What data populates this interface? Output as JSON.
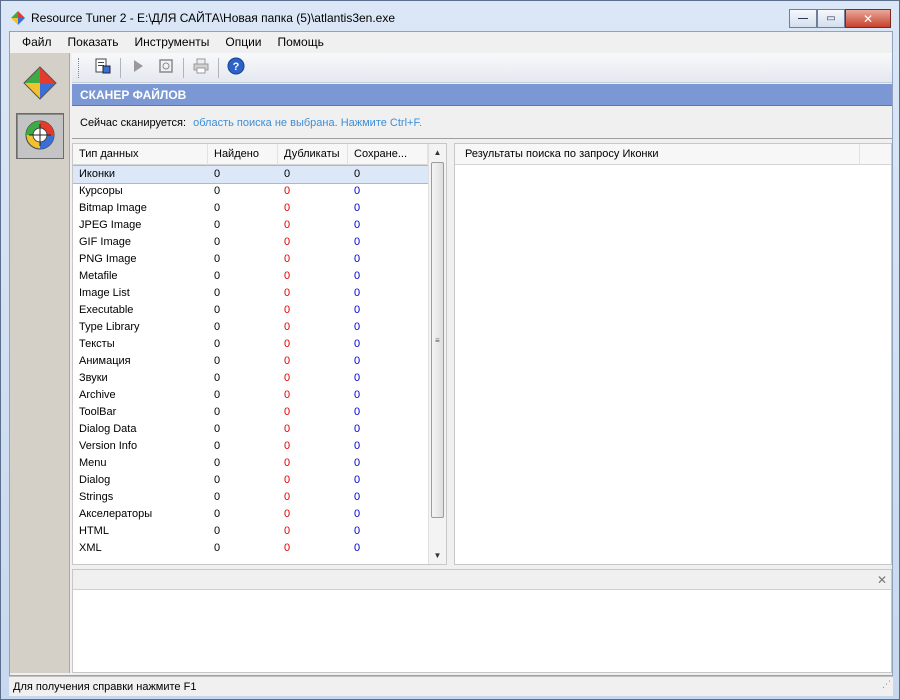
{
  "window": {
    "title": "Resource Tuner 2 - E:\\ДЛЯ САЙТА\\Новая папка (5)\\atlantis3en.exe"
  },
  "menu": {
    "items": [
      {
        "label": "Файл"
      },
      {
        "label": "Показать"
      },
      {
        "label": "Инструменты"
      },
      {
        "label": "Опции"
      },
      {
        "label": "Помощь"
      }
    ]
  },
  "toolbar": {
    "icons": [
      "open-file-icon",
      "play-icon",
      "stop-icon",
      "print-icon",
      "help-icon"
    ]
  },
  "section": {
    "title": "СКАНЕР ФАЙЛОВ"
  },
  "scan": {
    "label": "Сейчас сканируется:",
    "status": "область поиска не выбрана. Нажмите Ctrl+F."
  },
  "list": {
    "columns": [
      "Тип данных",
      "Найдено",
      "Дубликаты",
      "Сохране..."
    ],
    "rows": [
      {
        "type": "Иконки",
        "found": "0",
        "dup": "0",
        "saved": "0"
      },
      {
        "type": "Курсоры",
        "found": "0",
        "dup": "0",
        "saved": "0"
      },
      {
        "type": "Bitmap Image",
        "found": "0",
        "dup": "0",
        "saved": "0"
      },
      {
        "type": "JPEG Image",
        "found": "0",
        "dup": "0",
        "saved": "0"
      },
      {
        "type": "GIF Image",
        "found": "0",
        "dup": "0",
        "saved": "0"
      },
      {
        "type": "PNG Image",
        "found": "0",
        "dup": "0",
        "saved": "0"
      },
      {
        "type": "Metafile",
        "found": "0",
        "dup": "0",
        "saved": "0"
      },
      {
        "type": "Image List",
        "found": "0",
        "dup": "0",
        "saved": "0"
      },
      {
        "type": "Executable",
        "found": "0",
        "dup": "0",
        "saved": "0"
      },
      {
        "type": "Type Library",
        "found": "0",
        "dup": "0",
        "saved": "0"
      },
      {
        "type": "Тексты",
        "found": "0",
        "dup": "0",
        "saved": "0"
      },
      {
        "type": "Анимация",
        "found": "0",
        "dup": "0",
        "saved": "0"
      },
      {
        "type": "Звуки",
        "found": "0",
        "dup": "0",
        "saved": "0"
      },
      {
        "type": "Archive",
        "found": "0",
        "dup": "0",
        "saved": "0"
      },
      {
        "type": "ToolBar",
        "found": "0",
        "dup": "0",
        "saved": "0"
      },
      {
        "type": "Dialog Data",
        "found": "0",
        "dup": "0",
        "saved": "0"
      },
      {
        "type": "Version Info",
        "found": "0",
        "dup": "0",
        "saved": "0"
      },
      {
        "type": "Menu",
        "found": "0",
        "dup": "0",
        "saved": "0"
      },
      {
        "type": "Dialog",
        "found": "0",
        "dup": "0",
        "saved": "0"
      },
      {
        "type": "Strings",
        "found": "0",
        "dup": "0",
        "saved": "0"
      },
      {
        "type": "Акселераторы",
        "found": "0",
        "dup": "0",
        "saved": "0"
      },
      {
        "type": "HTML",
        "found": "0",
        "dup": "0",
        "saved": "0"
      },
      {
        "type": "XML",
        "found": "0",
        "dup": "0",
        "saved": "0"
      }
    ]
  },
  "results": {
    "header": "Результаты поиска по запросу Иконки"
  },
  "statusbar": {
    "text": "Для получения справки нажмите F1"
  },
  "colors": {
    "header_blue": "#7b98d4",
    "link_blue": "#3d8fd6",
    "dup_red": "#e00000",
    "saved_blue": "#0000d0"
  }
}
